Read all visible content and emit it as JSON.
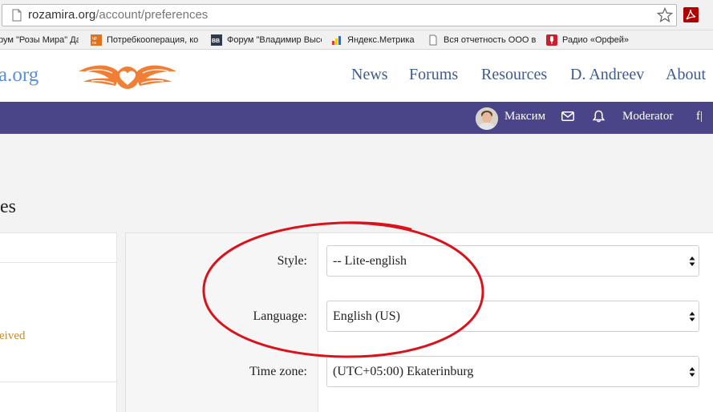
{
  "browser": {
    "url_host": "rozamira.org",
    "url_path": "/account/preferences",
    "bookmarks": [
      {
        "label": "рум \"Розы Мира\" Да",
        "icon": "page-icon"
      },
      {
        "label": "Потребкооперация, ко",
        "icon": "coop-icon"
      },
      {
        "label": "Форум \"Владимир Высо",
        "icon": "bb-icon"
      },
      {
        "label": "Яндекс.Метрика",
        "icon": "metrika-icon"
      },
      {
        "label": "Вся отчетность ООО в",
        "icon": "page-icon"
      },
      {
        "label": "Радио «Орфей»",
        "icon": "mic-icon"
      }
    ]
  },
  "header": {
    "brand": "a.org",
    "nav": [
      "News",
      "Forums",
      "Resources",
      "D. Andreev",
      "About"
    ]
  },
  "userbar": {
    "username": "Максим",
    "moderator": "Moderator",
    "edge": "f|"
  },
  "page": {
    "title": "es",
    "left_link": "eived"
  },
  "form": {
    "style_label": "Style:",
    "style_value": "-- Lite-english",
    "language_label": "Language:",
    "language_value": "English (US)",
    "timezone_label": "Time zone:",
    "timezone_value": "(UTC+05:00) Ekaterinburg"
  },
  "colors": {
    "nav_bar": "#494588",
    "nav_link": "#3f5a8e",
    "brand": "#5b8fd6",
    "logo": "#f07e35",
    "link_orange": "#cf8a29",
    "annotation": "#d9121c"
  }
}
